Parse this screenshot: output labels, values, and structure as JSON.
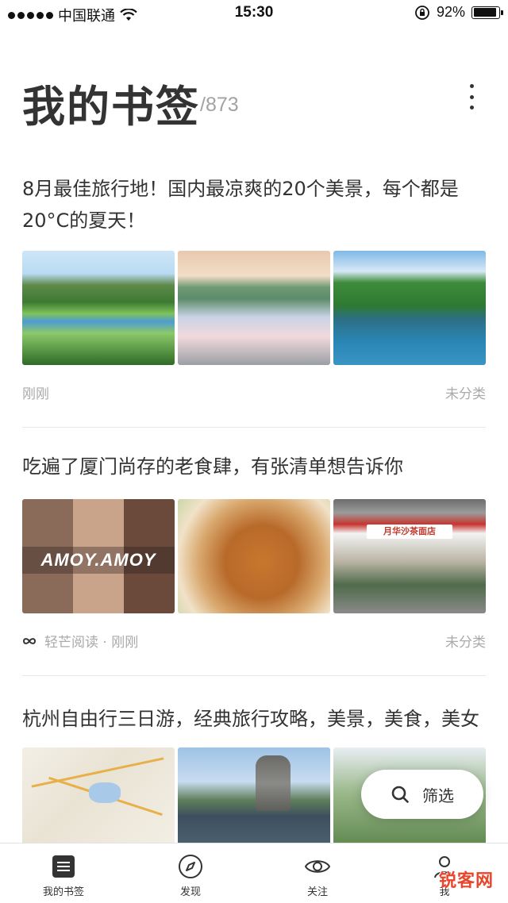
{
  "status_bar": {
    "carrier": "中国联通",
    "time": "15:30",
    "battery": "92%",
    "battery_level": 0.92,
    "signal_bars": 5
  },
  "header": {
    "title": "我的书签",
    "count": "/873",
    "more_icon": "more-vertical-icon"
  },
  "cards": [
    {
      "title": "8月最佳旅行地！国内最凉爽的20个美景，每个都是20°C的夏天！",
      "source": "",
      "time": "刚刚",
      "category": "未分类"
    },
    {
      "title": "吃遍了厦门尚存的老食肆，有张清单想告诉你",
      "thumb_overlay": "AMOY.AMOY",
      "shop_sign": "月华沙茶面店",
      "source": "轻芒阅读",
      "time": "刚刚",
      "category": "未分类"
    },
    {
      "title": "杭州自由行三日游，经典旅行攻略，美景，美食，美女"
    }
  ],
  "filter_button": {
    "label": "筛选",
    "icon": "search-icon"
  },
  "tabbar": {
    "items": [
      {
        "label": "我的书签",
        "icon": "bookmark-list-icon"
      },
      {
        "label": "发现",
        "icon": "compass-icon"
      },
      {
        "label": "关注",
        "icon": "eye-icon"
      },
      {
        "label": "我",
        "icon": "person-icon"
      }
    ]
  },
  "watermark": "锐客网"
}
